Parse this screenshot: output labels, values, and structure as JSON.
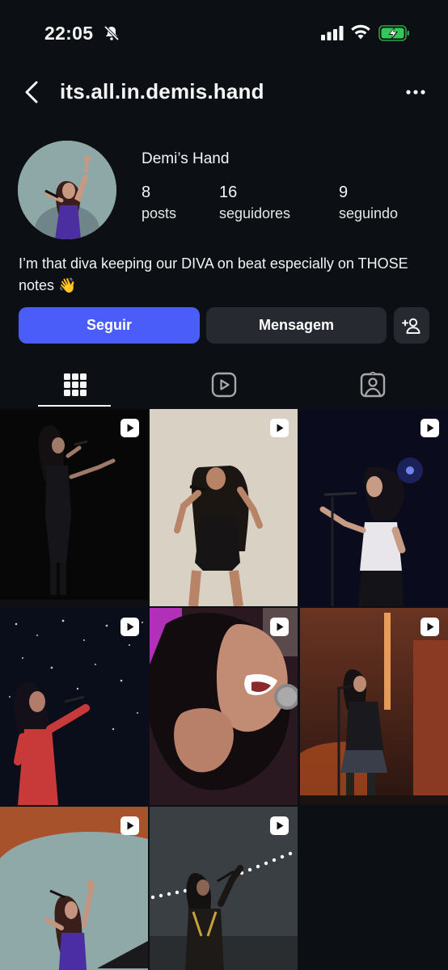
{
  "status_bar": {
    "time": "22:05"
  },
  "header": {
    "username": "its.all.in.demis.hand"
  },
  "profile": {
    "display_name": "Demi’s Hand",
    "stats": [
      {
        "value": "8",
        "label": "posts"
      },
      {
        "value": "16",
        "label": "seguidores"
      },
      {
        "value": "9",
        "label": "seguindo"
      }
    ],
    "bio": "I’m that diva keeping our DIVA on beat especially on THOSE notes 👋"
  },
  "actions": {
    "follow_label": "Seguir",
    "message_label": "Mensagem"
  },
  "tabs": [
    {
      "icon": "grid-icon",
      "active": true
    },
    {
      "icon": "reels-icon",
      "active": false
    },
    {
      "icon": "tagged-icon",
      "active": false
    }
  ],
  "colors": {
    "background": "#0c1014",
    "follow_button": "#4a5df9",
    "secondary_button": "#262a30",
    "battery_green": "#34c759"
  }
}
